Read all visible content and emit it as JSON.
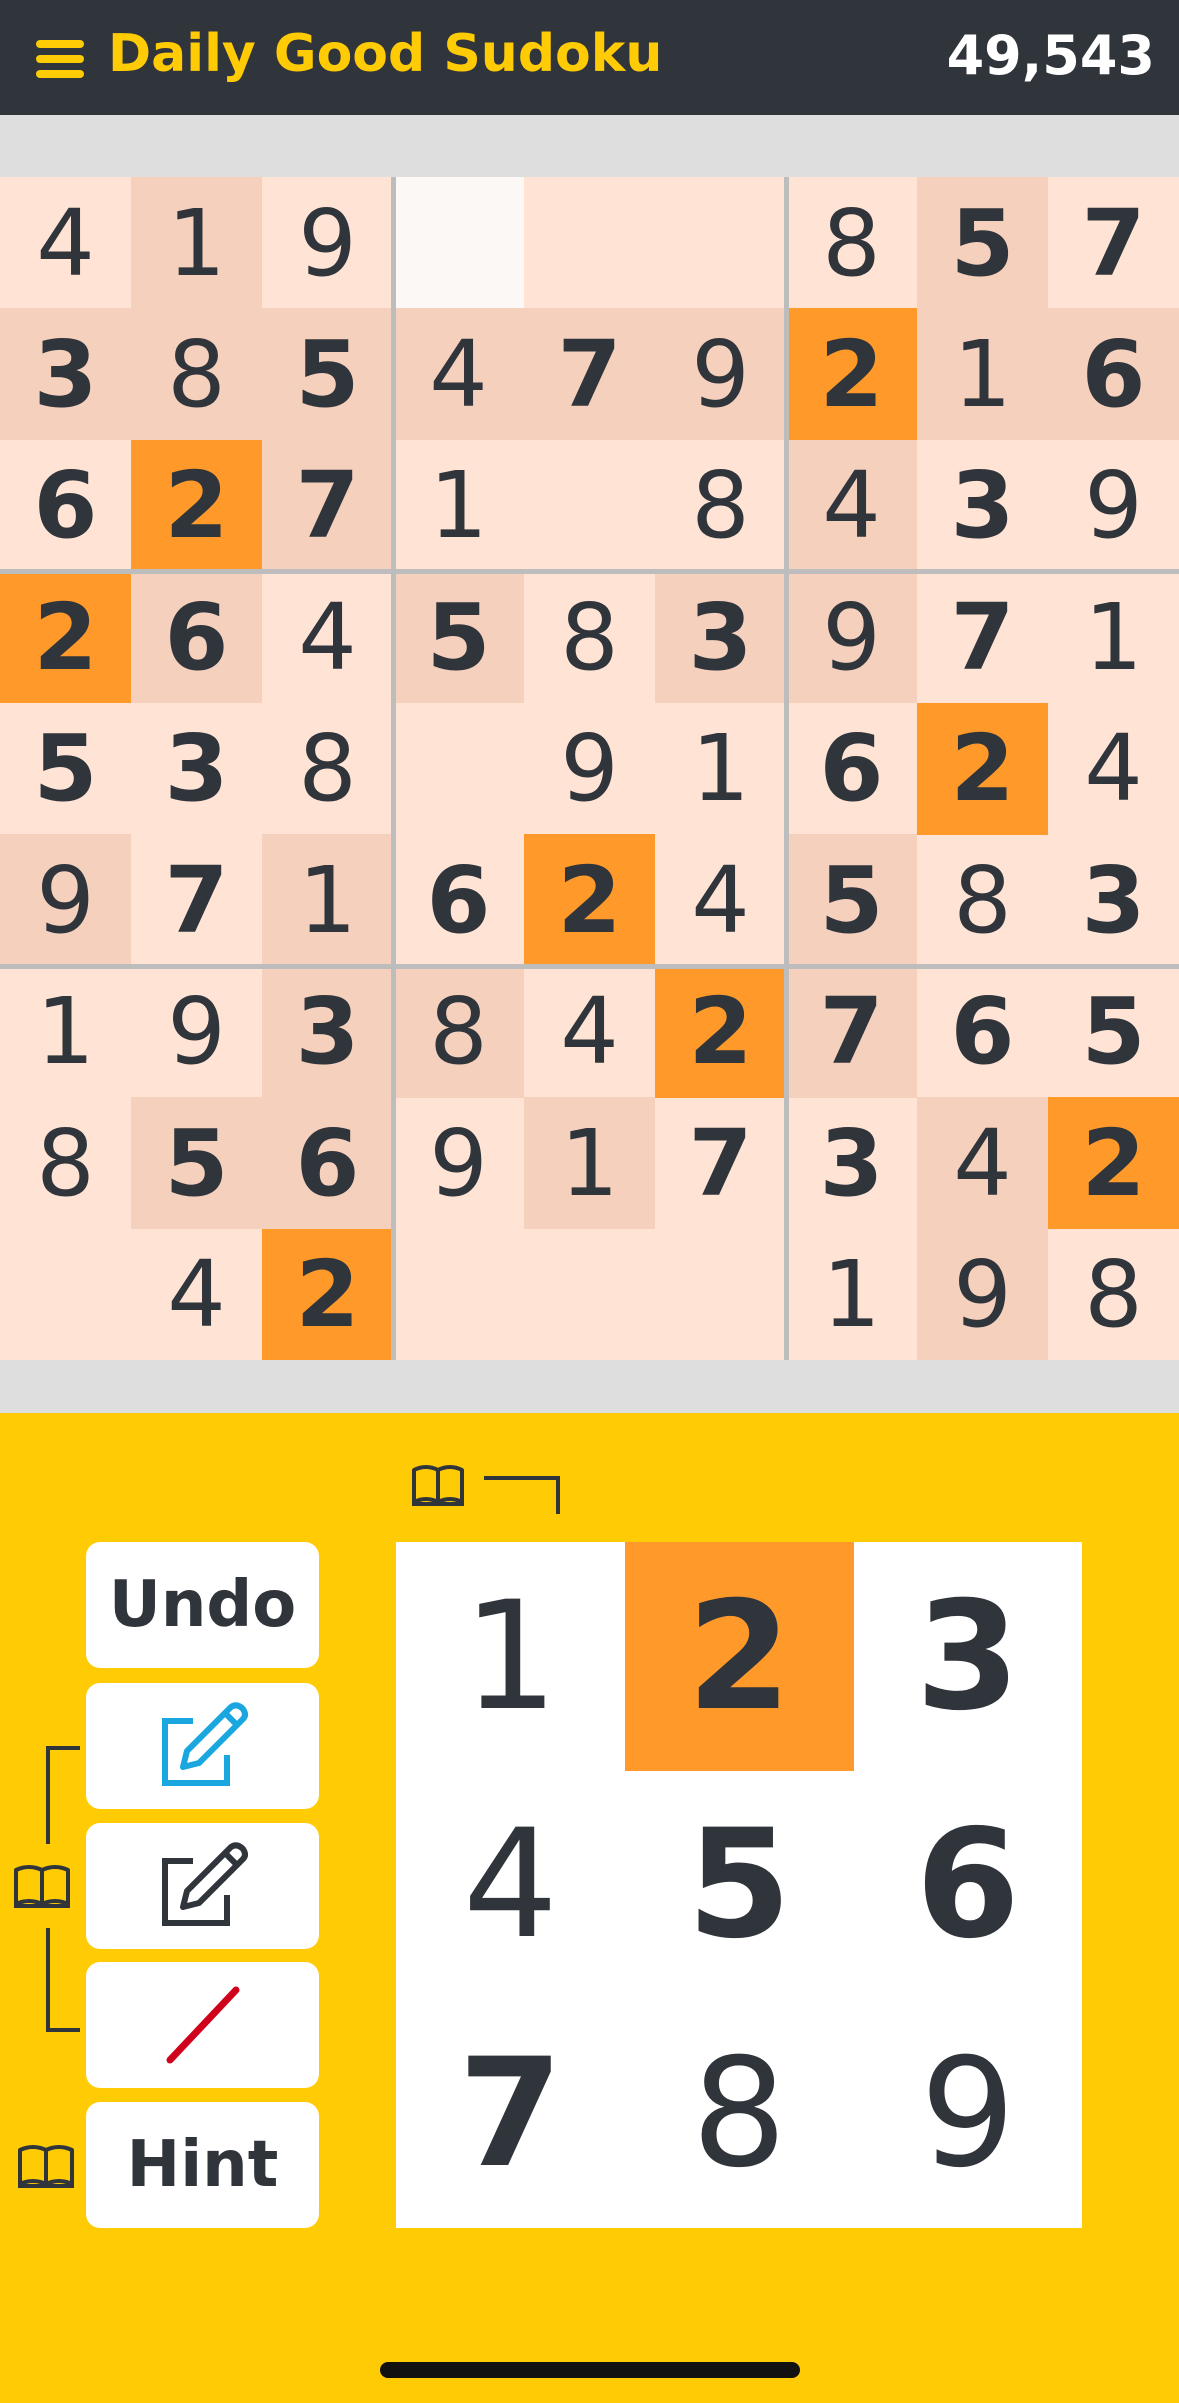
{
  "header": {
    "title": "Daily Good Sudoku",
    "score": "49,543"
  },
  "colors": {
    "header_bg": "#30343b",
    "accent": "#ffcb05",
    "cell_bg": "#ffe4d6",
    "cell_peer": "#f4d0bd",
    "highlight": "#ff9a2a",
    "selected": "#fbf8f5",
    "digit": "#30343b",
    "pencil_active": "#1aa6de",
    "eraser": "#d0021b"
  },
  "board": {
    "rows": [
      [
        "4",
        "1",
        "9",
        "",
        "",
        "",
        "8",
        "5",
        "7"
      ],
      [
        "3",
        "8",
        "5",
        "4",
        "7",
        "9",
        "2",
        "1",
        "6"
      ],
      [
        "6",
        "2",
        "7",
        "1",
        "",
        "8",
        "4",
        "3",
        "9"
      ],
      [
        "2",
        "6",
        "4",
        "5",
        "8",
        "3",
        "9",
        "7",
        "1"
      ],
      [
        "5",
        "3",
        "8",
        "",
        "9",
        "1",
        "6",
        "2",
        "4"
      ],
      [
        "9",
        "7",
        "1",
        "6",
        "2",
        "4",
        "5",
        "8",
        "3"
      ],
      [
        "1",
        "9",
        "3",
        "8",
        "4",
        "2",
        "7",
        "6",
        "5"
      ],
      [
        "8",
        "5",
        "6",
        "9",
        "1",
        "7",
        "3",
        "4",
        "2"
      ],
      [
        "",
        "4",
        "2",
        "",
        "",
        "",
        "1",
        "9",
        "8"
      ]
    ],
    "given": [
      [
        0,
        0,
        0,
        0,
        0,
        0,
        0,
        1,
        1
      ],
      [
        1,
        0,
        1,
        0,
        1,
        0,
        1,
        0,
        1
      ],
      [
        1,
        1,
        1,
        0,
        0,
        0,
        0,
        1,
        0
      ],
      [
        1,
        1,
        0,
        1,
        0,
        1,
        0,
        1,
        0
      ],
      [
        1,
        1,
        0,
        0,
        0,
        0,
        1,
        1,
        0
      ],
      [
        0,
        1,
        0,
        1,
        1,
        0,
        1,
        0,
        1
      ],
      [
        0,
        0,
        1,
        0,
        0,
        1,
        1,
        1,
        1
      ],
      [
        0,
        1,
        1,
        0,
        0,
        1,
        1,
        0,
        1
      ],
      [
        0,
        0,
        1,
        0,
        0,
        0,
        0,
        0,
        0
      ]
    ],
    "shade": [
      [
        "n",
        "p",
        "n",
        "s",
        "n",
        "n",
        "n",
        "p",
        "n"
      ],
      [
        "p",
        "p",
        "p",
        "p",
        "p",
        "p",
        "h",
        "p",
        "p"
      ],
      [
        "n",
        "h",
        "p",
        "n",
        "n",
        "n",
        "p",
        "n",
        "n"
      ],
      [
        "h",
        "p",
        "n",
        "p",
        "n",
        "p",
        "p",
        "n",
        "n"
      ],
      [
        "n",
        "n",
        "n",
        "n",
        "n",
        "n",
        "n",
        "h",
        "n"
      ],
      [
        "p",
        "n",
        "p",
        "n",
        "h",
        "n",
        "p",
        "n",
        "n"
      ],
      [
        "n",
        "n",
        "p",
        "p",
        "n",
        "h",
        "p",
        "n",
        "n"
      ],
      [
        "n",
        "p",
        "p",
        "n",
        "p",
        "n",
        "n",
        "p",
        "h"
      ],
      [
        "n",
        "n",
        "h",
        "n",
        "n",
        "n",
        "n",
        "p",
        "n"
      ]
    ]
  },
  "controls": {
    "undo_label": "Undo",
    "hint_label": "Hint",
    "numpad": [
      "1",
      "2",
      "3",
      "4",
      "5",
      "6",
      "7",
      "8",
      "9"
    ],
    "numpad_bold": [
      0,
      1,
      1,
      0,
      1,
      1,
      1,
      0,
      0
    ],
    "numpad_selected": "2"
  }
}
